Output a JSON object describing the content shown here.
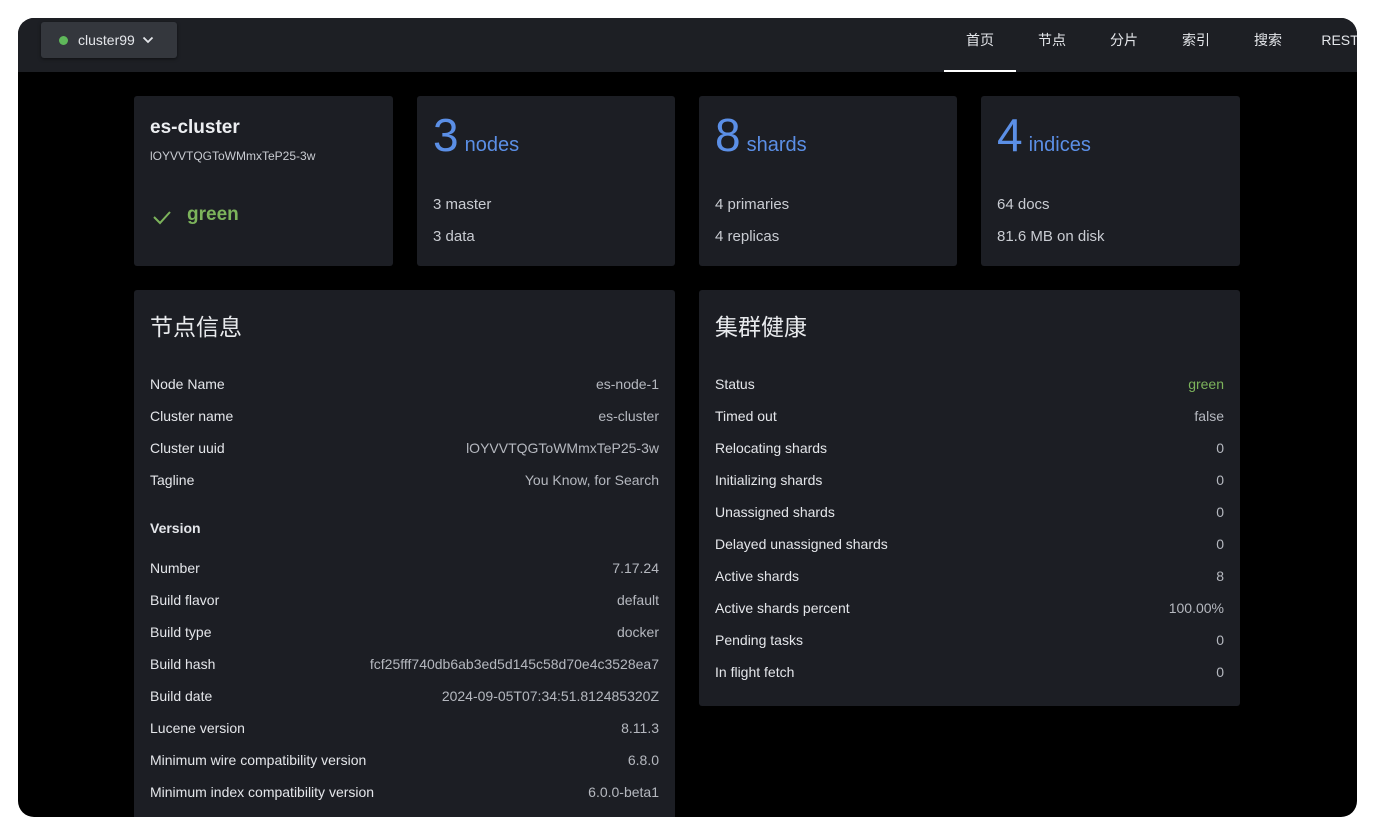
{
  "colors": {
    "accent": "#5b8fe6",
    "status_green": "#7cb35b",
    "status_dot": "#5fb85a"
  },
  "header": {
    "cluster_selector": {
      "label": "cluster99",
      "status_icon": "green-dot-icon",
      "dropdown_icon": "chevron-down-icon"
    },
    "tabs": [
      {
        "label": "首页",
        "active": true
      },
      {
        "label": "节点",
        "active": false
      },
      {
        "label": "分片",
        "active": false
      },
      {
        "label": "索引",
        "active": false
      },
      {
        "label": "搜索",
        "active": false
      },
      {
        "label": "REST",
        "active": false
      }
    ]
  },
  "cluster_card": {
    "name": "es-cluster",
    "uuid": "lOYVVTQGToWMmxTeP25-3w",
    "status": "green",
    "status_icon": "check-icon"
  },
  "nodes_card": {
    "count": "3",
    "unit": "nodes",
    "line1": "3 master",
    "line2": "3 data"
  },
  "shards_card": {
    "count": "8",
    "unit": "shards",
    "line1": "4 primaries",
    "line2": "4 replicas"
  },
  "indices_card": {
    "count": "4",
    "unit": "indices",
    "line1": "64 docs",
    "line2": "81.6 MB on disk"
  },
  "node_info": {
    "title": "节点信息",
    "rows": [
      {
        "key": "Node Name",
        "value": "es-node-1"
      },
      {
        "key": "Cluster name",
        "value": "es-cluster"
      },
      {
        "key": "Cluster uuid",
        "value": "lOYVVTQGToWMmxTeP25-3w"
      },
      {
        "key": "Tagline",
        "value": "You Know, for Search"
      }
    ],
    "version_heading": "Version",
    "version_rows": [
      {
        "key": "Number",
        "value": "7.17.24"
      },
      {
        "key": "Build flavor",
        "value": "default"
      },
      {
        "key": "Build type",
        "value": "docker"
      },
      {
        "key": "Build hash",
        "value": "fcf25fff740db6ab3ed5d145c58d70e4c3528ea7"
      },
      {
        "key": "Build date",
        "value": "2024-09-05T07:34:51.812485320Z"
      },
      {
        "key": "Lucene version",
        "value": "8.11.3"
      },
      {
        "key": "Minimum wire compatibility version",
        "value": "6.8.0"
      },
      {
        "key": "Minimum index compatibility version",
        "value": "6.0.0-beta1"
      }
    ]
  },
  "cluster_health": {
    "title": "集群健康",
    "rows": [
      {
        "key": "Status",
        "value": "green"
      },
      {
        "key": "Timed out",
        "value": "false"
      },
      {
        "key": "Relocating shards",
        "value": "0"
      },
      {
        "key": "Initializing shards",
        "value": "0"
      },
      {
        "key": "Unassigned shards",
        "value": "0"
      },
      {
        "key": "Delayed unassigned shards",
        "value": "0"
      },
      {
        "key": "Active shards",
        "value": "8"
      },
      {
        "key": "Active shards percent",
        "value": "100.00%"
      },
      {
        "key": "Pending tasks",
        "value": "0"
      },
      {
        "key": "In flight fetch",
        "value": "0"
      }
    ]
  }
}
